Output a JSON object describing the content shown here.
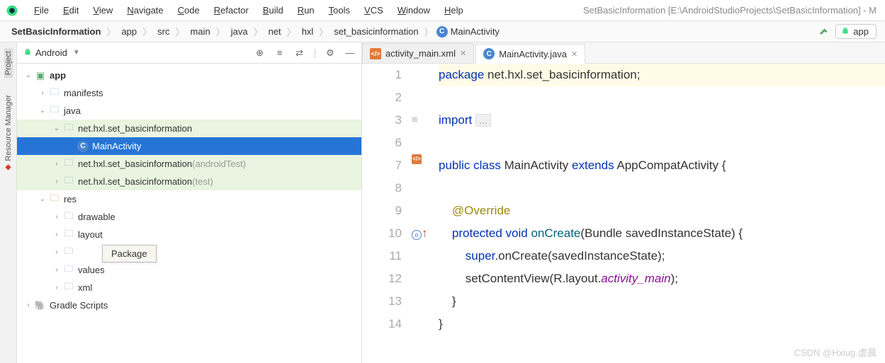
{
  "window_title": "SetBasicInformation [E:\\AndroidStudioProjects\\SetBasicInformation] - M",
  "menu": [
    "File",
    "Edit",
    "View",
    "Navigate",
    "Code",
    "Refactor",
    "Build",
    "Run",
    "Tools",
    "VCS",
    "Window",
    "Help"
  ],
  "breadcrumbs": [
    {
      "label": "SetBasicInformation",
      "bold": true
    },
    {
      "label": "app",
      "bold": false
    },
    {
      "label": "src",
      "bold": false
    },
    {
      "label": "main",
      "bold": false
    },
    {
      "label": "java",
      "bold": false
    },
    {
      "label": "net",
      "bold": false
    },
    {
      "label": "hxl",
      "bold": false
    },
    {
      "label": "set_basicinformation",
      "bold": false
    },
    {
      "label": "MainActivity",
      "bold": false,
      "icon": "c"
    }
  ],
  "run_config": "app",
  "side_tabs": [
    "Project",
    "Resource Manager"
  ],
  "project_title": "Android",
  "tree": [
    {
      "indent": 0,
      "arrow": "down",
      "icon": "app",
      "label": "app",
      "bold": true
    },
    {
      "indent": 1,
      "arrow": "right",
      "icon": "folder",
      "label": "manifests"
    },
    {
      "indent": 1,
      "arrow": "down",
      "icon": "folder",
      "label": "java"
    },
    {
      "indent": 2,
      "arrow": "down",
      "icon": "pkg",
      "label": "net.hxl.set_basicinformation",
      "hl": "green"
    },
    {
      "indent": 3,
      "arrow": "",
      "icon": "c",
      "label": "MainActivity",
      "selected": true
    },
    {
      "indent": 2,
      "arrow": "right",
      "icon": "pkg",
      "label": "net.hxl.set_basicinformation",
      "suffix": "(androidTest)",
      "hl": "green"
    },
    {
      "indent": 2,
      "arrow": "right",
      "icon": "pkg",
      "label": "net.hxl.set_basicinformation",
      "suffix": "(test)",
      "hl": "green"
    },
    {
      "indent": 1,
      "arrow": "down",
      "icon": "res",
      "label": "res"
    },
    {
      "indent": 2,
      "arrow": "right",
      "icon": "folder",
      "label": "drawable"
    },
    {
      "indent": 2,
      "arrow": "right",
      "icon": "folder",
      "label": "layout"
    },
    {
      "indent": 2,
      "arrow": "right",
      "icon": "folder",
      "label": ""
    },
    {
      "indent": 2,
      "arrow": "right",
      "icon": "folder",
      "label": "values"
    },
    {
      "indent": 2,
      "arrow": "right",
      "icon": "folder",
      "label": "xml"
    },
    {
      "indent": 0,
      "arrow": "right",
      "icon": "gradle",
      "label": "Gradle Scripts"
    }
  ],
  "tooltip": "Package",
  "editor_tabs": [
    {
      "label": "activity_main.xml",
      "icon": "xml",
      "active": false
    },
    {
      "label": "MainActivity.java",
      "icon": "c",
      "active": true
    }
  ],
  "code_lines": [
    {
      "n": 1,
      "html": "<span class='kw'>package</span> net.hxl.set_basicinformation;",
      "bg": "y"
    },
    {
      "n": 2,
      "html": ""
    },
    {
      "n": 3,
      "html": "<span class='kw'>import</span> <span class='fold'>...</span>",
      "fold": "plus"
    },
    {
      "n": 6,
      "html": ""
    },
    {
      "n": 7,
      "html": "<span class='kw'>public</span> <span class='kw'>class</span> MainActivity <span class='kw'>extends</span> AppCompatActivity {",
      "mark": "xml-tag"
    },
    {
      "n": 8,
      "html": ""
    },
    {
      "n": 9,
      "html": "    <span class='ann'>@Override</span>"
    },
    {
      "n": 10,
      "html": "    <span class='kw'>protected</span> <span class='kw'>void</span> <span class='mtd'>onCreate</span>(Bundle savedInstanceState) {",
      "mark": "override"
    },
    {
      "n": 11,
      "html": "        <span class='kw'>super</span>.onCreate(savedInstanceState);"
    },
    {
      "n": 12,
      "html": "        setContentView(R.layout.<span class='it'>activity_main</span>);"
    },
    {
      "n": 13,
      "html": "    }"
    },
    {
      "n": 14,
      "html": "}"
    }
  ],
  "watermark": "CSDN @Hxiug.虚晨"
}
